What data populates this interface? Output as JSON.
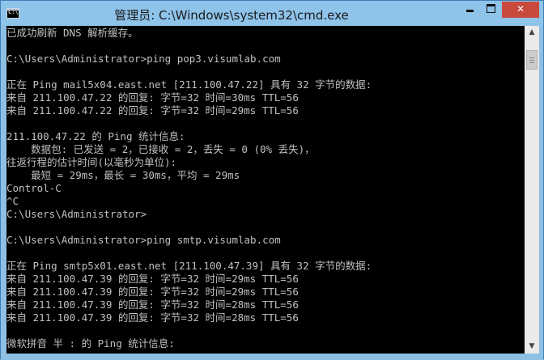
{
  "window": {
    "title": "管理员: C:\\Windows\\system32\\cmd.exe",
    "app_icon": "cmd-icon",
    "controls": {
      "minimize": "minimize-icon",
      "maximize": "maximize-icon",
      "close_label": "✕"
    }
  },
  "console": {
    "lines": [
      "已成功刷新 DNS 解析缓存。",
      "",
      "C:\\Users\\Administrator>ping pop3.visumlab.com",
      "",
      "正在 Ping mail5x04.east.net [211.100.47.22] 具有 32 字节的数据:",
      "来自 211.100.47.22 的回复: 字节=32 时间=30ms TTL=56",
      "来自 211.100.47.22 的回复: 字节=32 时间=29ms TTL=56",
      "",
      "211.100.47.22 的 Ping 统计信息:",
      "    数据包: 已发送 = 2，已接收 = 2，丢失 = 0 (0% 丢失)，",
      "往返行程的估计时间(以毫秒为单位):",
      "    最短 = 29ms，最长 = 30ms，平均 = 29ms",
      "Control-C",
      "^C",
      "C:\\Users\\Administrator>",
      "",
      "C:\\Users\\Administrator>ping smtp.visumlab.com",
      "",
      "正在 Ping smtp5x01.east.net [211.100.47.39] 具有 32 字节的数据:",
      "来自 211.100.47.39 的回复: 字节=32 时间=29ms TTL=56",
      "来自 211.100.47.39 的回复: 字节=32 时间=29ms TTL=56",
      "来自 211.100.47.39 的回复: 字节=32 时间=28ms TTL=56",
      "来自 211.100.47.39 的回复: 字节=32 时间=28ms TTL=56",
      "",
      "微软拼音 半 : 的 Ping 统计信息:"
    ],
    "text_color": "#c0c0c0",
    "background": "#000000"
  },
  "scrollbar": {
    "up_arrow": "▲",
    "down_arrow": "▼"
  }
}
